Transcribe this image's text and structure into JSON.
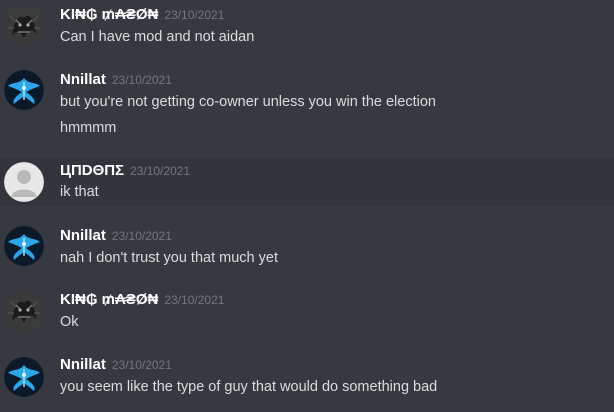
{
  "messages": [
    {
      "author": "KI₦₲ ₥₳₴Ø₦",
      "timestamp": "23/10/2021",
      "avatar": "dark-creature-avatar",
      "lines": [
        "Can I have mod and not aidan"
      ]
    },
    {
      "author": "Nnillat",
      "timestamp": "23/10/2021",
      "avatar": "blue-phoenix-avatar",
      "lines": [
        "but you're not getting co-owner unless you win the election",
        "hmmmm"
      ]
    },
    {
      "author": "ЦПDΘПΣ",
      "timestamp": "23/10/2021",
      "avatar": "default-user-avatar",
      "lines": [
        "ik that"
      ]
    },
    {
      "author": "Nnillat",
      "timestamp": "23/10/2021",
      "avatar": "blue-phoenix-avatar",
      "lines": [
        "nah I don't trust you that much yet"
      ]
    },
    {
      "author": "KI₦₲ ₥₳₴Ø₦",
      "timestamp": "23/10/2021",
      "avatar": "dark-creature-avatar",
      "lines": [
        "Ok"
      ]
    },
    {
      "author": "Nnillat",
      "timestamp": "23/10/2021",
      "avatar": "blue-phoenix-avatar",
      "lines": [
        "you seem like the type of guy that would do something bad"
      ]
    }
  ],
  "colors": {
    "background": "#36393f",
    "hover_background": "#32353b",
    "username": "#ffffff",
    "timestamp": "#72767d",
    "message_text": "#dcddde"
  }
}
